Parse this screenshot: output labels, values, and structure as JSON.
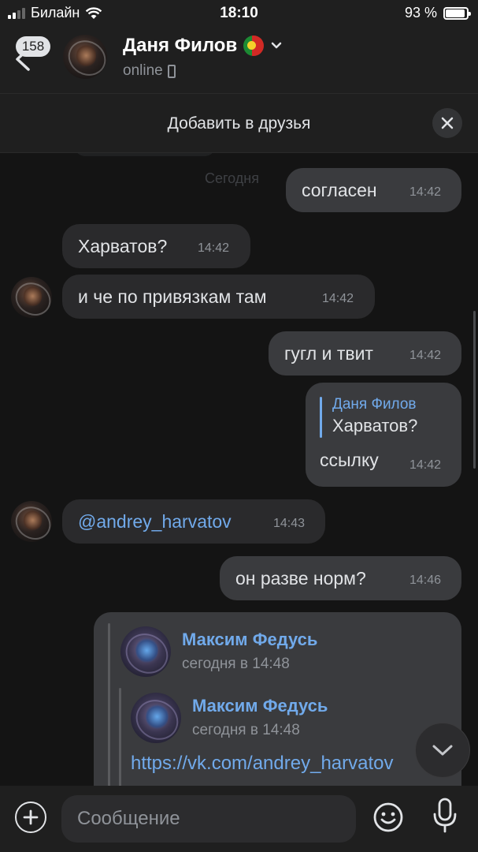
{
  "status_bar": {
    "carrier": "Билайн",
    "time": "18:10",
    "battery_text": "93 %",
    "battery_level_percent": 93
  },
  "header": {
    "unread_badge": "158",
    "contact_name": "Даня Филов",
    "status": "online",
    "icons": [
      "back-arrow-icon",
      "portugal-flag-icon",
      "chevron-down-icon",
      "phone-device-icon"
    ]
  },
  "add_friend_bar": {
    "label": "Добавить в друзья",
    "icon": "close-icon"
  },
  "chat": {
    "date_separator": "Сегодня",
    "messages": [
      {
        "dir": "out",
        "text": "согласен",
        "time": "14:42"
      },
      {
        "dir": "in",
        "text": "Харватов?",
        "time": "14:42"
      },
      {
        "dir": "in",
        "text": "и че по привязкам там",
        "time": "14:42"
      },
      {
        "dir": "out",
        "text": "гугл и твит",
        "time": "14:42"
      },
      {
        "dir": "out",
        "reply_to_name": "Даня Филов",
        "reply_to_text": "Харватов?",
        "text": "ссылку",
        "time": "14:42"
      },
      {
        "dir": "in",
        "text": "@andrey_harvatov",
        "time": "14:43"
      },
      {
        "dir": "out",
        "text": "он разве норм?",
        "time": "14:46"
      },
      {
        "dir": "out",
        "forwarded": {
          "name": "Максим Федусь",
          "date": "сегодня в 14:48",
          "nested": {
            "name": "Максим Федусь",
            "date": "сегодня в 14:48",
            "link": "https://vk.com/andrey_harvatov"
          }
        }
      }
    ]
  },
  "input_bar": {
    "placeholder": "Сообщение",
    "value": "",
    "icons": [
      "plus-icon",
      "emoji-icon",
      "microphone-icon"
    ]
  },
  "colors": {
    "background": "#141414",
    "panel": "#1f1f1f",
    "incoming_bubble": "#2a2a2c",
    "outgoing_bubble": "#3a3b3e",
    "accent_link": "#71aaeb",
    "secondary_text": "#8f9399"
  }
}
